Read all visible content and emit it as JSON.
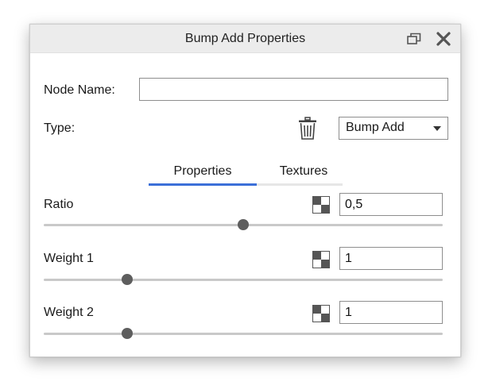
{
  "dialog": {
    "title": "Bump Add Properties",
    "node_name_label": "Node Name:",
    "node_name_value": "",
    "type_label": "Type:",
    "type_value": "Bump Add",
    "tabs": [
      {
        "label": "Properties",
        "active": true
      },
      {
        "label": "Textures",
        "active": false
      }
    ],
    "properties": [
      {
        "label": "Ratio",
        "value": "0,5",
        "slider_fraction": 0.5
      },
      {
        "label": "Weight 1",
        "value": "1",
        "slider_fraction": 0.21
      },
      {
        "label": "Weight 2",
        "value": "1",
        "slider_fraction": 0.21
      }
    ]
  },
  "icons": {
    "restore": "restore-window-icon",
    "close": "close-icon",
    "delete": "trash-icon",
    "texture_map": "checker-map-icon"
  },
  "colors": {
    "accent": "#3b6fd8",
    "titlebar": "#ececec",
    "thumb": "#5e5e5e"
  }
}
